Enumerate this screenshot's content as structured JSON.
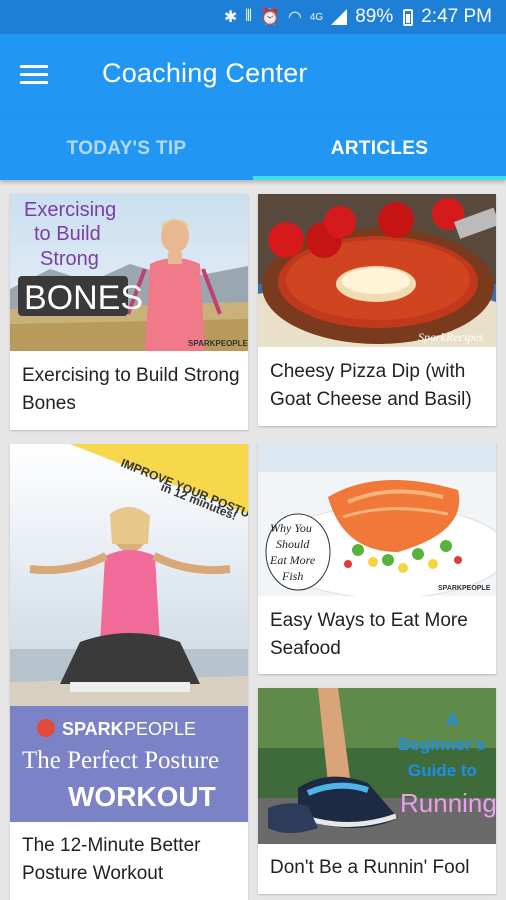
{
  "status_bar": {
    "battery": "89%",
    "time": "2:47 PM",
    "network": "4G"
  },
  "app_bar": {
    "title": "Coaching Center",
    "menu_icon": "hamburger-menu-icon"
  },
  "tabs": [
    {
      "label": "TODAY'S TIP",
      "active": false
    },
    {
      "label": "ARTICLES",
      "active": true
    }
  ],
  "colors": {
    "primary": "#2196f3",
    "status": "#1e7fd6",
    "tab_indicator": "#40e0ea"
  },
  "articles": [
    {
      "title": "Exercising to Build Strong Bones",
      "image_text": [
        "Exercising",
        "to Build",
        "Strong",
        "BONES"
      ],
      "watermark": "SPARKPEOPLE"
    },
    {
      "title": "Cheesy Pizza Dip (with Goat Cheese and Basil)",
      "watermark": "SparkRecipes"
    },
    {
      "title": "The 12-Minute Better Posture Workout",
      "image_text": [
        "IMPROVE YOUR POSTURE",
        "in 12 minutes!",
        "SPARKPEOPLE",
        "The Perfect Posture",
        "WORKOUT"
      ]
    },
    {
      "title": "Easy Ways to Eat More Seafood",
      "image_text": [
        "Why You",
        "Should",
        "Eat More",
        "Fish"
      ],
      "watermark": "SPARKPEOPLE"
    },
    {
      "title": "Don't Be a Runnin' Fool",
      "image_text": [
        "A",
        "Beginner's",
        "Guide to",
        "Running"
      ]
    }
  ]
}
